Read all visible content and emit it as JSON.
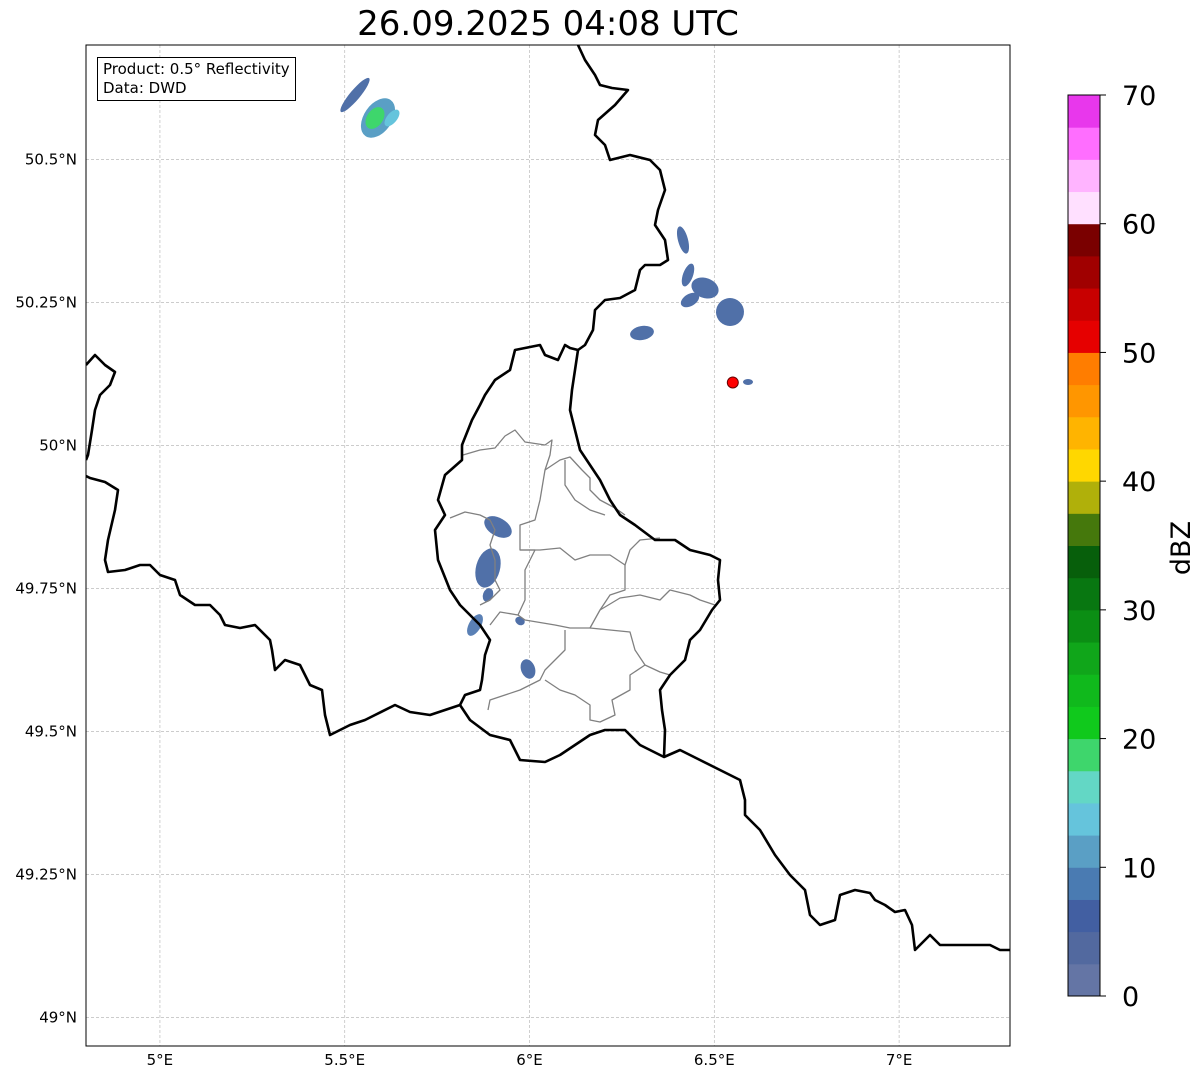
{
  "title": "26.09.2025 04:08 UTC",
  "info_box": {
    "product": "Product: 0.5° Reflectivity",
    "source": "Data: DWD"
  },
  "map": {
    "extent_lon": [
      4.8,
      7.3
    ],
    "extent_lat": [
      48.95,
      50.7
    ],
    "gridlines": true,
    "lon_ticks": [
      "5°E",
      "5.5°E",
      "6°E",
      "6.5°E",
      "7°E"
    ],
    "lon_values": [
      5.0,
      5.5,
      6.0,
      6.5,
      7.0
    ],
    "lat_ticks": [
      "50.5°N",
      "50.25°N",
      "50°N",
      "49.75°N",
      "49.5°N",
      "49.25°N",
      "49°N"
    ],
    "lat_values": [
      50.5,
      50.25,
      50.0,
      49.75,
      49.5,
      49.25,
      49.0
    ],
    "radar_site": {
      "lon": 6.55,
      "lat": 50.11,
      "color": "#ff0000"
    },
    "echo_color": "#5070a8"
  },
  "colorbar": {
    "label": "dBZ",
    "range": [
      0,
      70
    ],
    "tick_labels": [
      "0",
      "10",
      "20",
      "30",
      "40",
      "50",
      "60",
      "70"
    ],
    "tick_values": [
      0,
      10,
      20,
      30,
      40,
      50,
      60,
      70
    ],
    "bin_width": 2.5,
    "colors": [
      "#6475a5",
      "#52699f",
      "#425fa2",
      "#4a7bb2",
      "#5a9fc5",
      "#65c4dc",
      "#63d7c5",
      "#3ed66c",
      "#10c91c",
      "#10b91c",
      "#10a61a",
      "#0b8e14",
      "#087711",
      "#075f0b",
      "#45780c",
      "#b0b00a",
      "#ffd700",
      "#ffb400",
      "#ff9600",
      "#ff7d00",
      "#e60000",
      "#c80000",
      "#a00000",
      "#7a0000",
      "#ffe0ff",
      "#ffb4ff",
      "#ff6eff",
      "#e837ec"
    ]
  }
}
